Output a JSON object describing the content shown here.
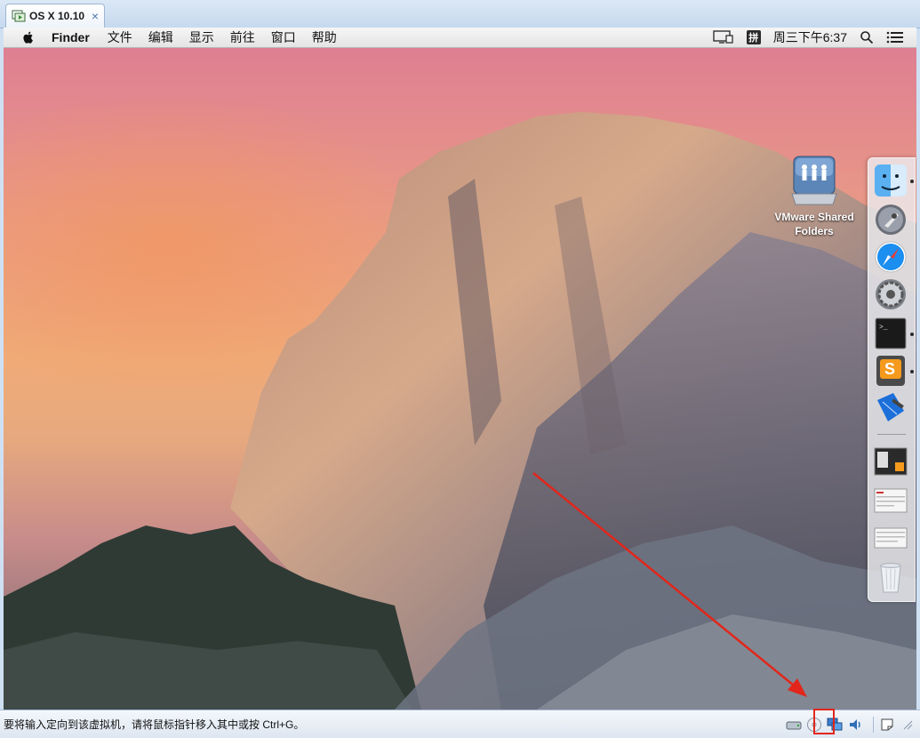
{
  "window": {
    "tab_title": "OS X 10.10",
    "tab_close": "×"
  },
  "menubar": {
    "app_name": "Finder",
    "menus": [
      "文件",
      "编辑",
      "显示",
      "前往",
      "窗口",
      "帮助"
    ],
    "input_method": "拼",
    "clock": "周三下午6:37"
  },
  "desktop": {
    "shared_folder_label_line1": "VMware Shared",
    "shared_folder_label_line2": "Folders"
  },
  "dock": {
    "items": [
      "finder-icon",
      "launchpad-icon",
      "safari-icon",
      "system-preferences-icon",
      "terminal-icon",
      "sublime-text-icon",
      "xcode-icon",
      "window-thumbnail-1",
      "window-thumbnail-2",
      "window-thumbnail-3",
      "trash-icon"
    ]
  },
  "statusbar": {
    "hint": "要将输入定向到该虚拟机，请将鼠标指针移入其中或按 Ctrl+G。"
  },
  "colors": {
    "arrow": "#e2261b",
    "highlight_box": "#e2261b"
  }
}
